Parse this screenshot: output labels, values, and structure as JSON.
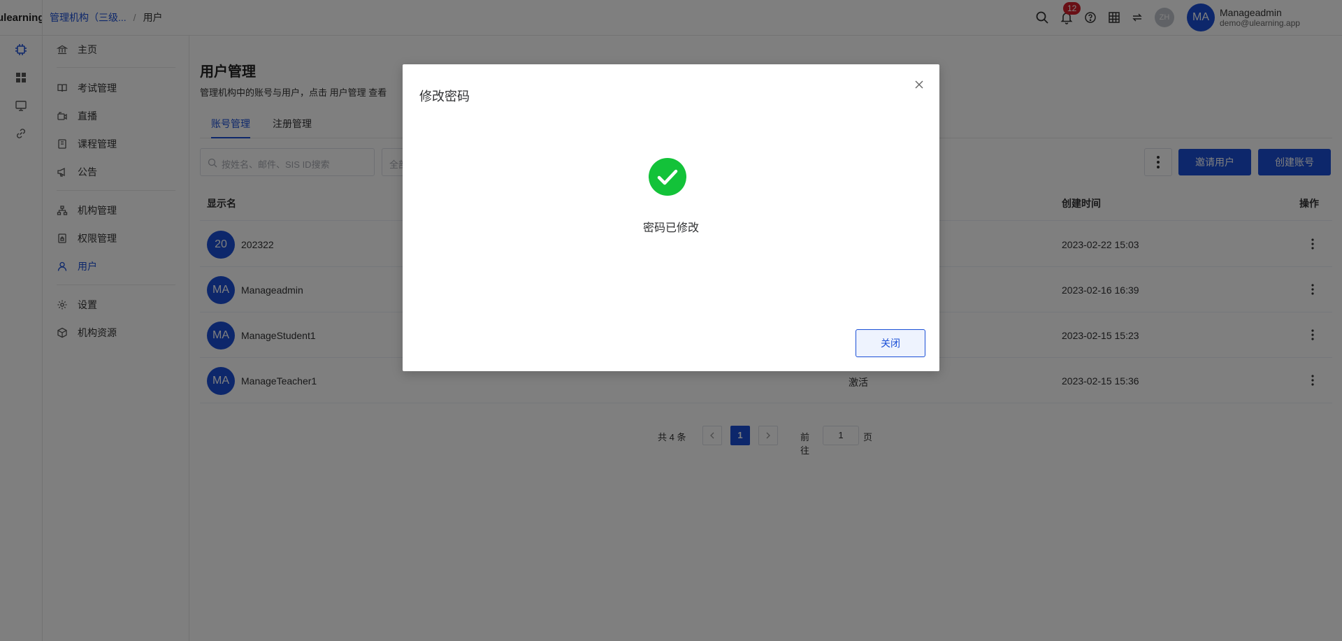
{
  "app": {
    "logo_text": "ulearning"
  },
  "breadcrumb": {
    "parent": "管理机构（三级...",
    "separator": "/",
    "current": "用户"
  },
  "header": {
    "notification_count": "12",
    "lang_avatar": "ZH",
    "user": {
      "initials": "MA",
      "name": "Manageadmin",
      "email": "demo@ulearning.app"
    }
  },
  "sidebar": {
    "items": [
      {
        "label": "主页",
        "icon": "bank-icon"
      },
      {
        "label": "考试管理",
        "icon": "book-open-icon"
      },
      {
        "label": "直播",
        "icon": "video-icon"
      },
      {
        "label": "课程管理",
        "icon": "book-icon"
      },
      {
        "label": "公告",
        "icon": "megaphone-icon"
      },
      {
        "label": "机构管理",
        "icon": "org-tree-icon"
      },
      {
        "label": "权限管理",
        "icon": "permission-icon"
      },
      {
        "label": "用户",
        "icon": "user-icon"
      },
      {
        "label": "设置",
        "icon": "gear-icon"
      },
      {
        "label": "机构资源",
        "icon": "cube-icon"
      }
    ]
  },
  "main": {
    "title": "用户管理",
    "description": "管理机构中的账号与用户，点击 用户管理 查看",
    "tabs": [
      {
        "label": "账号管理",
        "active": true
      },
      {
        "label": "注册管理",
        "active": false
      }
    ],
    "search_placeholder": "按姓名、邮件、SIS ID搜索",
    "filter_placeholder": "全部",
    "invite_button": "邀请用户",
    "create_button": "创建账号",
    "columns": {
      "display_name": "显示名",
      "created": "创建时间",
      "actions": "操作"
    },
    "rows": [
      {
        "initials": "20",
        "name": "202322",
        "status": "",
        "created": "2023-02-22 15:03"
      },
      {
        "initials": "MA",
        "name": "Manageadmin",
        "status": "",
        "created": "2023-02-16 16:39"
      },
      {
        "initials": "MA",
        "name": "ManageStudent1",
        "status": "",
        "created": "2023-02-15 15:23"
      },
      {
        "initials": "MA",
        "name": "ManageTeacher1",
        "status": "激活",
        "created": "2023-02-15 15:36"
      }
    ],
    "pagination": {
      "total": "共 4 条",
      "current": "1",
      "goto": "前往",
      "goto_value": "1",
      "page_unit": "页"
    }
  },
  "modal": {
    "title": "修改密码",
    "message": "密码已修改",
    "close_button": "关闭"
  },
  "colors": {
    "primary": "#1a4fd6",
    "success": "#13c239",
    "badge": "#d21f2a"
  }
}
